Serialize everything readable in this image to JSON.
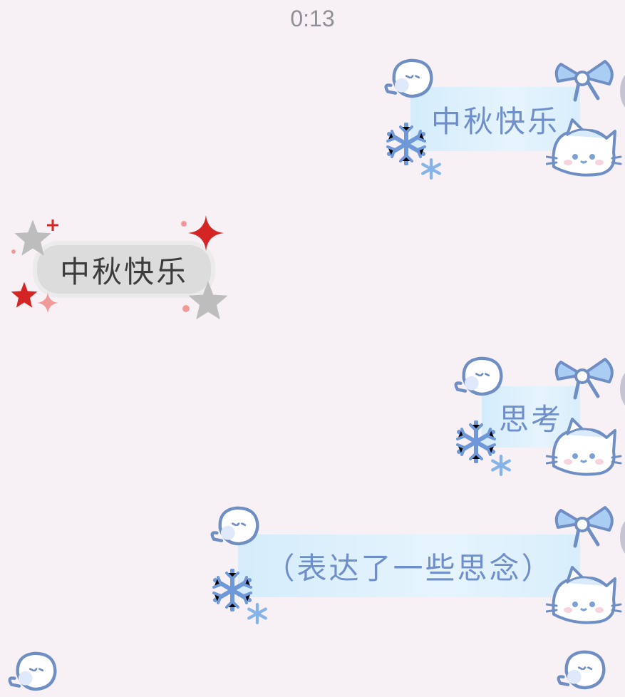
{
  "chat": {
    "timestamp": "0:13",
    "messages": [
      {
        "direction": "outgoing",
        "text": "中秋快乐"
      },
      {
        "direction": "incoming",
        "text": "中秋快乐"
      },
      {
        "direction": "outgoing",
        "text": "思考"
      },
      {
        "direction": "outgoing",
        "text": "（表达了一些思念）"
      }
    ]
  },
  "theme": {
    "background": "#f7f1f6",
    "outgoing_bubble": "#d8eefc",
    "outgoing_text": "#6e8fcb",
    "incoming_bubble": "#dcdcdc",
    "incoming_text": "#3c3c3c",
    "star_red": "#d42424",
    "star_gray": "#bdbdbd"
  },
  "decor_icons": [
    "snowman-icon",
    "snowflake-icon",
    "bow-icon",
    "cat-icon",
    "star-icon",
    "sparkle-icon"
  ]
}
